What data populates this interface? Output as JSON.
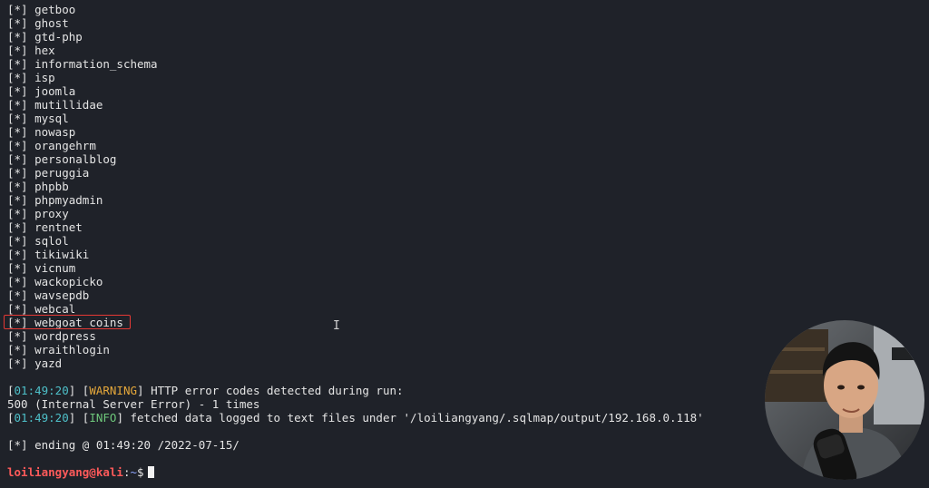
{
  "databases": [
    "getboo",
    "ghost",
    "gtd-php",
    "hex",
    "information_schema",
    "isp",
    "joomla",
    "mutillidae",
    "mysql",
    "nowasp",
    "orangehrm",
    "personalblog",
    "peruggia",
    "phpbb",
    "phpmyadmin",
    "proxy",
    "rentnet",
    "sqlol",
    "tikiwiki",
    "vicnum",
    "wackopicko",
    "wavsepdb",
    "webcal",
    "webgoat_coins",
    "wordpress",
    "wraithlogin",
    "yazd"
  ],
  "highlighted_database": "webgoat_coins",
  "bullet_prefix": "[*]",
  "log": {
    "warning_time": "01:49:20",
    "warning_tag": "WARNING",
    "warning_text": "HTTP error codes detected during run:",
    "error_line": "500 (Internal Server Error) - 1 times",
    "info_time": "01:49:20",
    "info_tag": "INFO",
    "info_text": "fetched data logged to text files under '/loiliangyang/.sqlmap/output/192.168.0.118'",
    "ending_line": "ending @ 01:49:20 /2022-07-15/"
  },
  "prompt": {
    "user_host": "loiliangyang@kali",
    "separator": ":",
    "cwd": "~",
    "symbol": "$"
  },
  "colors": {
    "background": "#1f2229",
    "timestamp": "#4ec0c9",
    "warning": "#e5a83b",
    "info": "#6ec87b",
    "prompt_user": "#ff5a5a",
    "prompt_path": "#8fa6ff",
    "highlight_box": "#e53935"
  },
  "icons": {
    "mouse_cursor": "i-beam-cursor-icon",
    "webcam": "presenter-webcam-overlay"
  }
}
